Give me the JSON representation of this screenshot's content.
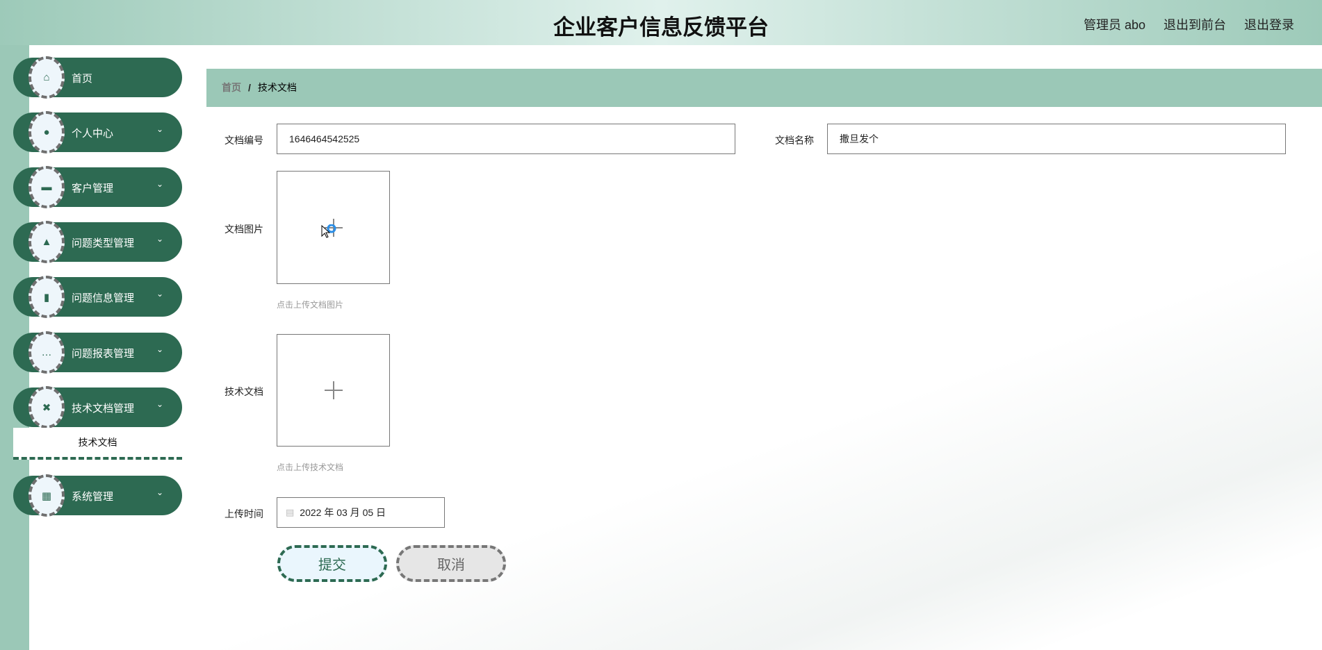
{
  "header": {
    "title": "企业客户信息反馈平台",
    "user": "管理员 abo",
    "to_front": "退出到前台",
    "logout": "退出登录"
  },
  "sidebar": {
    "items": [
      {
        "label": "首页",
        "icon": "home-icon"
      },
      {
        "label": "个人中心",
        "icon": "user-icon"
      },
      {
        "label": "客户管理",
        "icon": "monitor-icon"
      },
      {
        "label": "问题类型管理",
        "icon": "person-icon"
      },
      {
        "label": "问题信息管理",
        "icon": "book-icon"
      },
      {
        "label": "问题报表管理",
        "icon": "chat-icon"
      },
      {
        "label": "技术文档管理",
        "icon": "ticket-icon"
      },
      {
        "label": "系统管理",
        "icon": "grid-icon"
      }
    ],
    "submenu": {
      "label": "技术文档"
    }
  },
  "breadcrumb": {
    "home": "首页",
    "sep": "/",
    "current": "技术文档"
  },
  "form": {
    "doc_no_label": "文档编号",
    "doc_no": "1646464542525",
    "doc_name_label": "文档名称",
    "doc_name": "撒旦发个",
    "image_label": "文档图片",
    "image_hint": "点击上传文档图片",
    "file_label": "技术文档",
    "file_hint": "点击上传技术文档",
    "time_label": "上传时间",
    "time": "2022 年 03 月 05 日",
    "submit": "提交",
    "cancel": "取消"
  },
  "colors": {
    "primary": "#2d6a52",
    "accent": "#9bc8b7"
  }
}
